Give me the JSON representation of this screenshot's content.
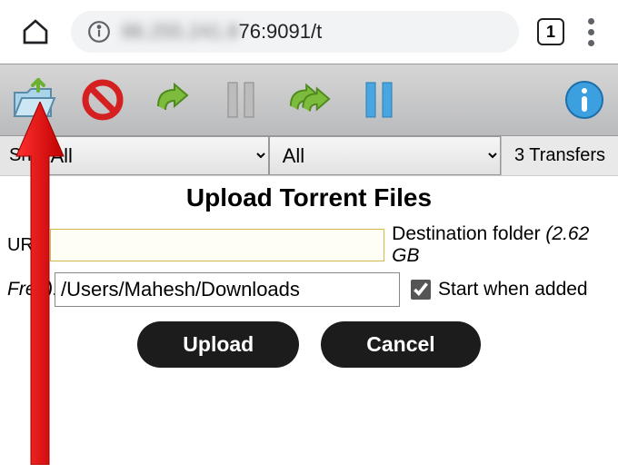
{
  "browser": {
    "url_blurred": "86.255.241.8",
    "url_visible": "76:9091/t",
    "tab_count": "1"
  },
  "filters": {
    "show_label": "Sh",
    "filter1": "All",
    "filter2": "All",
    "transfers_text": "3 Transfers"
  },
  "dialog": {
    "title": "Upload Torrent Files",
    "url_label": "URL",
    "dest_label": "Destination folder ",
    "dest_free": "(2.62 GB",
    "free_label": "Free):",
    "path_value": "/Users/Mahesh/Downloads",
    "start_label": "Start when added",
    "upload_label": "Upload",
    "cancel_label": "Cancel"
  }
}
